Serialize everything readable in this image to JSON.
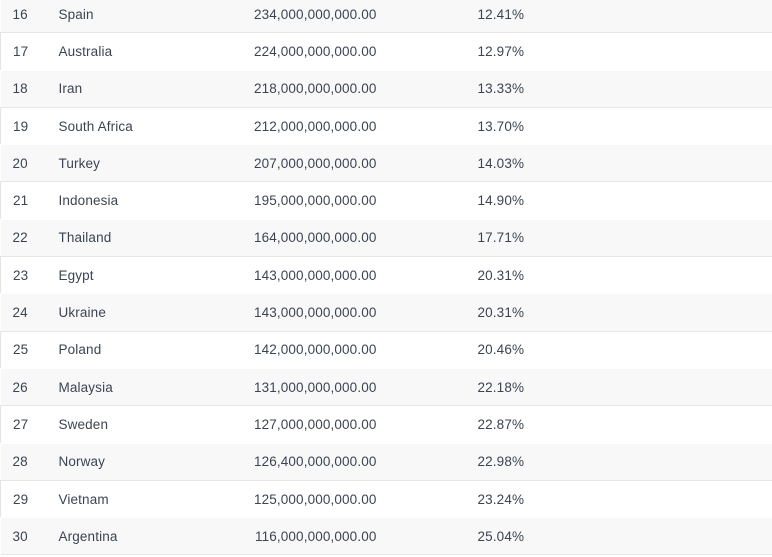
{
  "table": {
    "columns": [
      {
        "key": "rank",
        "align": "left"
      },
      {
        "key": "country",
        "align": "left"
      },
      {
        "key": "value",
        "align": "right"
      },
      {
        "key": "percent",
        "align": "left"
      }
    ],
    "rows": [
      {
        "rank": "16",
        "country": "Spain",
        "value": "234,000,000,000.00",
        "percent": "12.41%"
      },
      {
        "rank": "17",
        "country": "Australia",
        "value": "224,000,000,000.00",
        "percent": "12.97%"
      },
      {
        "rank": "18",
        "country": "Iran",
        "value": "218,000,000,000.00",
        "percent": "13.33%"
      },
      {
        "rank": "19",
        "country": "South Africa",
        "value": "212,000,000,000.00",
        "percent": "13.70%"
      },
      {
        "rank": "20",
        "country": "Turkey",
        "value": "207,000,000,000.00",
        "percent": "14.03%"
      },
      {
        "rank": "21",
        "country": "Indonesia",
        "value": "195,000,000,000.00",
        "percent": "14.90%"
      },
      {
        "rank": "22",
        "country": "Thailand",
        "value": "164,000,000,000.00",
        "percent": "17.71%"
      },
      {
        "rank": "23",
        "country": "Egypt",
        "value": "143,000,000,000.00",
        "percent": "20.31%"
      },
      {
        "rank": "24",
        "country": "Ukraine",
        "value": "143,000,000,000.00",
        "percent": "20.31%"
      },
      {
        "rank": "25",
        "country": "Poland",
        "value": "142,000,000,000.00",
        "percent": "20.46%"
      },
      {
        "rank": "26",
        "country": "Malaysia",
        "value": "131,000,000,000.00",
        "percent": "22.18%"
      },
      {
        "rank": "27",
        "country": "Sweden",
        "value": "127,000,000,000.00",
        "percent": "22.87%"
      },
      {
        "rank": "28",
        "country": "Norway",
        "value": "126,400,000,000.00",
        "percent": "22.98%"
      },
      {
        "rank": "29",
        "country": "Vietnam",
        "value": "125,000,000,000.00",
        "percent": "23.24%"
      },
      {
        "rank": "30",
        "country": "Argentina",
        "value": "116,000,000,000.00",
        "percent": "25.04%"
      }
    ]
  },
  "colors": {
    "row_shaded_background": "#f8f8f8",
    "row_plain_background": "#ffffff",
    "row_border": "#e7e7e7",
    "text": "#3c4452",
    "page_background": "#ffffff"
  }
}
